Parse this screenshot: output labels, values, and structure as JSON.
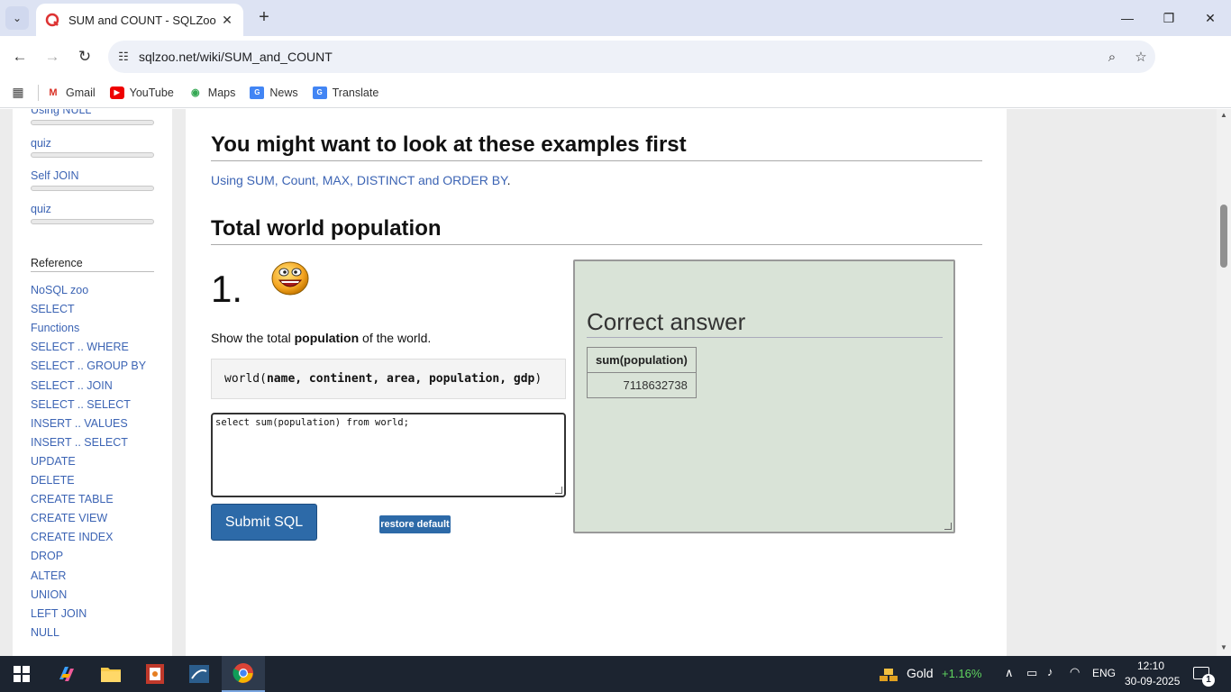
{
  "browser": {
    "tab_title": "SUM and COUNT - SQLZoo",
    "url": "sqlzoo.net/wiki/SUM_and_COUNT",
    "bookmarks": [
      {
        "label": "Gmail",
        "icon": "gmail-icon"
      },
      {
        "label": "YouTube",
        "icon": "youtube-icon"
      },
      {
        "label": "Maps",
        "icon": "maps-icon"
      },
      {
        "label": "News",
        "icon": "news-icon"
      },
      {
        "label": "Translate",
        "icon": "translate-icon"
      }
    ]
  },
  "sidebar": {
    "top_links": [
      "Using NULL",
      "quiz",
      "Self JOIN",
      "quiz"
    ],
    "reference_heading": "Reference",
    "reference_links": [
      "NoSQL zoo",
      "SELECT",
      "Functions",
      "SELECT .. WHERE",
      "SELECT .. GROUP BY",
      "SELECT .. JOIN",
      "SELECT .. SELECT",
      "INSERT .. VALUES",
      "INSERT .. SELECT",
      "UPDATE",
      "DELETE",
      "CREATE TABLE",
      "CREATE VIEW",
      "CREATE INDEX",
      "DROP",
      "ALTER",
      "UNION",
      "LEFT JOIN",
      "NULL"
    ]
  },
  "main": {
    "examples_heading": "You might want to look at these examples first",
    "examples_link": "Using SUM, Count, MAX, DISTINCT and ORDER BY",
    "examples_dot": ".",
    "section_heading": "Total world population",
    "question_number": "1.",
    "question_prefix": "Show the total ",
    "question_bold": "population",
    "question_suffix": " of the world.",
    "schema_table": "world(",
    "schema_cols": "name, continent, area, population, gdp",
    "schema_close": ")",
    "sql_query": "select sum(population) from world;",
    "submit_label": "Submit SQL",
    "restore_label": "restore default"
  },
  "answer": {
    "heading": "Correct answer",
    "column": "sum(population)",
    "value": "7118632738",
    "bg_color": "#d9e3d7"
  },
  "taskbar": {
    "widget_label": "Gold",
    "widget_change": "+1.16%",
    "language": "ENG",
    "time": "12:10",
    "date": "30-09-2025",
    "notification_count": "1"
  }
}
